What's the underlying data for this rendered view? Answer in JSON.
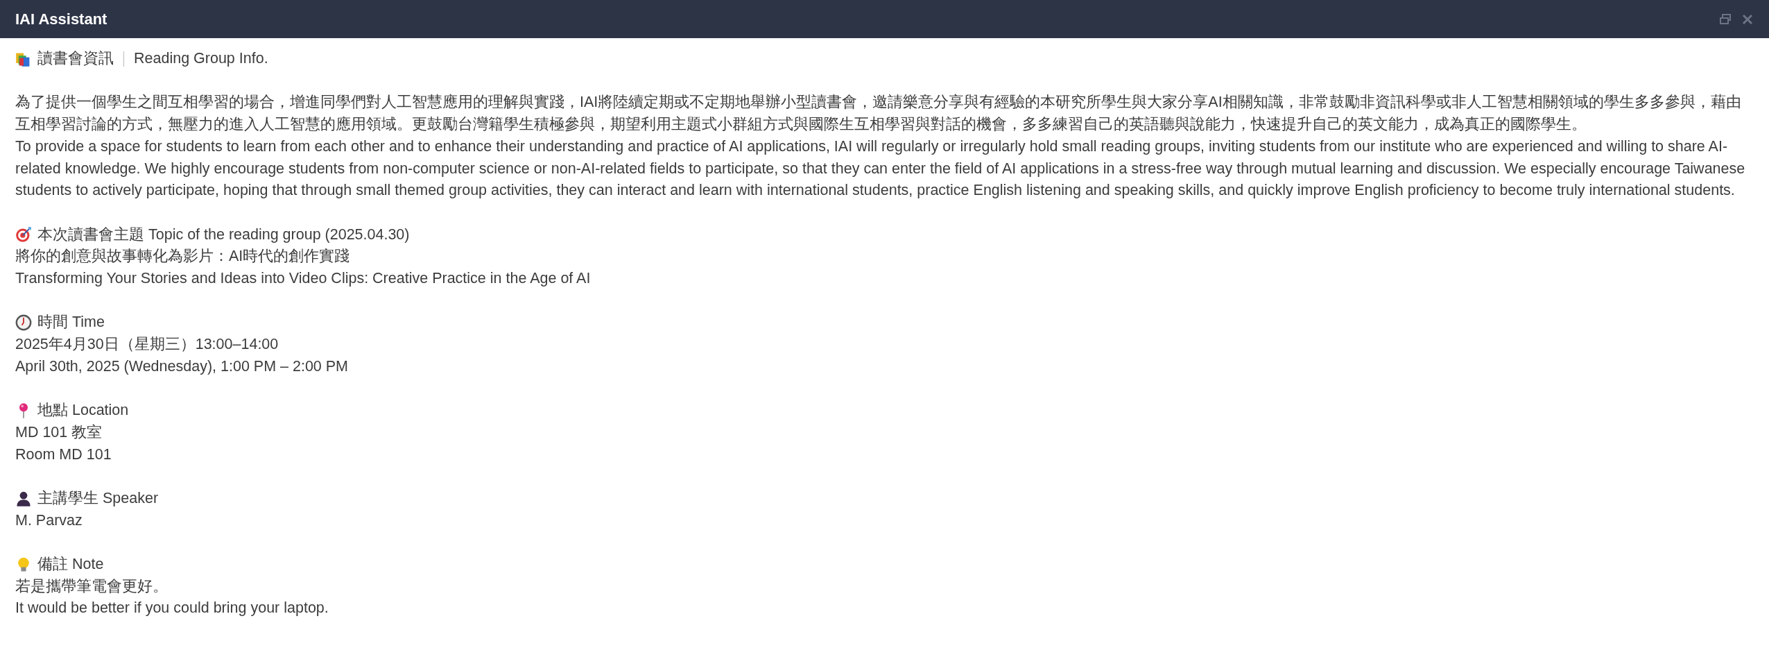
{
  "window": {
    "title": "IAI Assistant"
  },
  "intro": {
    "kind": "books",
    "title": "讀書會資訊",
    "subtitle": "Reading Group Info.",
    "paragraphs": [
      "為了提供一個學生之間互相學習的場合，增進同學們對人工智慧應用的理解與實踐，IAI將陸續定期或不定期地舉辦小型讀書會，邀請樂意分享與有經驗的本研究所學生與大家分享AI相關知識，非常鼓勵非資訊科學或非人工智慧相關領域的學生多多參與，藉由互相學習討論的方式，無壓力的進入人工智慧的應用領域。更鼓勵台灣籍學生積極參與，期望利用主題式小群組方式與國際生互相學習與對話的機會，多多練習自己的英語聽與說能力，快速提升自己的英文能力，成為真正的國際學生。",
      "To provide a space for students to learn from each other and to enhance their understanding and practice of AI applications, IAI will regularly or irregularly hold small reading groups, inviting students from our institute who are experienced and willing to share AI-related knowledge. We highly encourage students from non-computer science or non-AI-related fields to participate, so that they can enter the field of AI applications in a stress-free way through mutual learning and discussion. We especially encourage Taiwanese students to actively participate, hoping that through small themed group activities, they can interact and learn with international students, practice English listening and speaking skills, and quickly improve English proficiency to become truly international students."
    ]
  },
  "sections": [
    {
      "kind": "target",
      "heading": "本次讀書會主題 Topic of the reading group (2025.04.30)",
      "lines": [
        "將你的創意與故事轉化為影片：AI時代的創作實踐",
        "Transforming Your Stories and Ideas into Video Clips: Creative Practice in the Age of AI"
      ]
    },
    {
      "kind": "clock",
      "heading": "時間 Time",
      "lines": [
        "2025年4月30日（星期三）13:00–14:00",
        "April 30th, 2025 (Wednesday), 1:00 PM – 2:00 PM"
      ]
    },
    {
      "kind": "pin",
      "heading": "地點 Location",
      "lines": [
        "MD 101 教室",
        "Room MD 101"
      ]
    },
    {
      "kind": "person",
      "heading": "主講學生 Speaker",
      "lines": [
        "M. Parvaz"
      ]
    },
    {
      "kind": "bulb",
      "heading": "備註 Note",
      "lines": [
        "若是攜帶筆電會更好。",
        "It would be better if you could bring your laptop."
      ]
    }
  ]
}
